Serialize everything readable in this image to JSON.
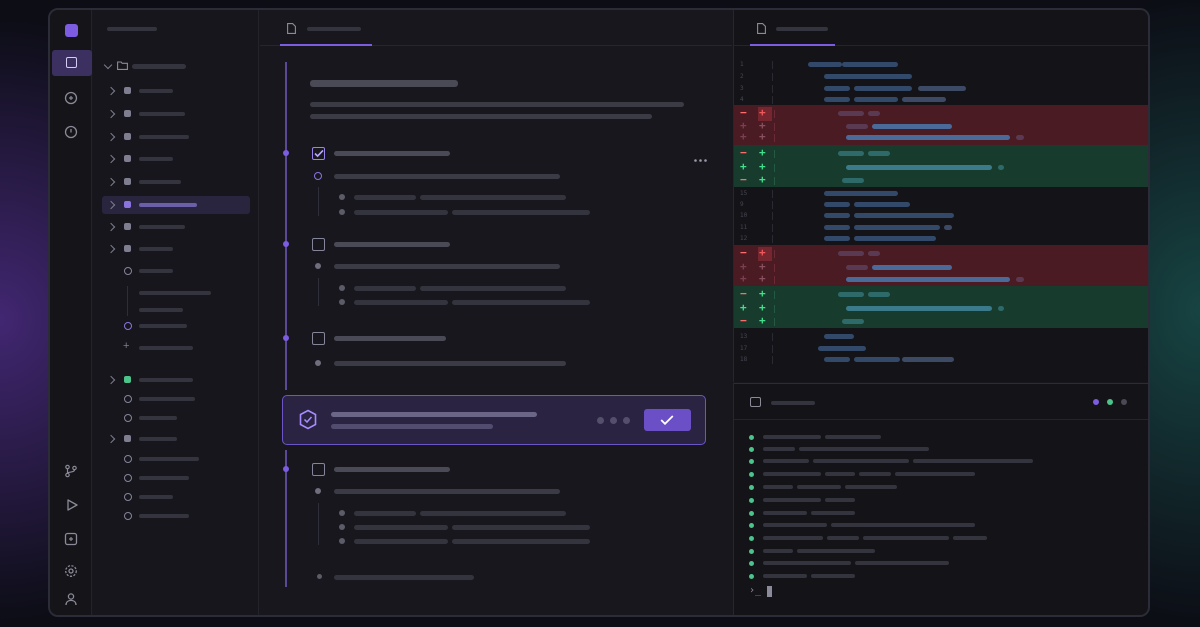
{
  "colors": {
    "accent": "#7c5ce0",
    "accent_fill": "#6a4fc6",
    "added": "#42e08c",
    "removed": "#ff6b6b",
    "terminal_dot": "#4cc38a",
    "window_bg": "#17171d"
  },
  "activity_bar": {
    "top": [
      "app-logo-icon",
      "explorer-icon",
      "chat-icon",
      "history-icon"
    ],
    "bottom": [
      "source-control-icon",
      "run-icon",
      "extensions-icon",
      "settings-icon",
      "account-icon"
    ]
  },
  "editor": {
    "tab_icon": "document-icon",
    "task_more_icon": "more-icon",
    "task_checked": [
      true,
      false,
      false,
      false
    ],
    "approval": {
      "icon": "shield-icon",
      "button_icon": "check-icon"
    }
  },
  "diff": {
    "tab_icon": "document-icon",
    "line_numbers": [
      "1",
      "2",
      "3",
      "4",
      "",
      "",
      "",
      "",
      "",
      "",
      "",
      "",
      "15",
      "9",
      "10",
      "11",
      "12",
      "",
      "",
      "",
      "",
      "",
      "",
      "",
      "",
      "13",
      "17",
      "18"
    ],
    "markers": [
      {
        "sign": "−",
        "sign2": "+",
        "kind": "removed"
      },
      {
        "sign": "+",
        "sign2": "+",
        "kind": "removed"
      },
      {
        "sign": "+",
        "sign2": "+",
        "kind": "removed"
      },
      {
        "sign": "−",
        "sign2": "+",
        "kind": "added"
      },
      {
        "sign": "+",
        "sign2": "+",
        "kind": "added"
      },
      {
        "sign": "−",
        "sign2": "+",
        "kind": "added"
      }
    ]
  },
  "terminal": {
    "icon": "terminal-icon",
    "prompt": "›_"
  }
}
